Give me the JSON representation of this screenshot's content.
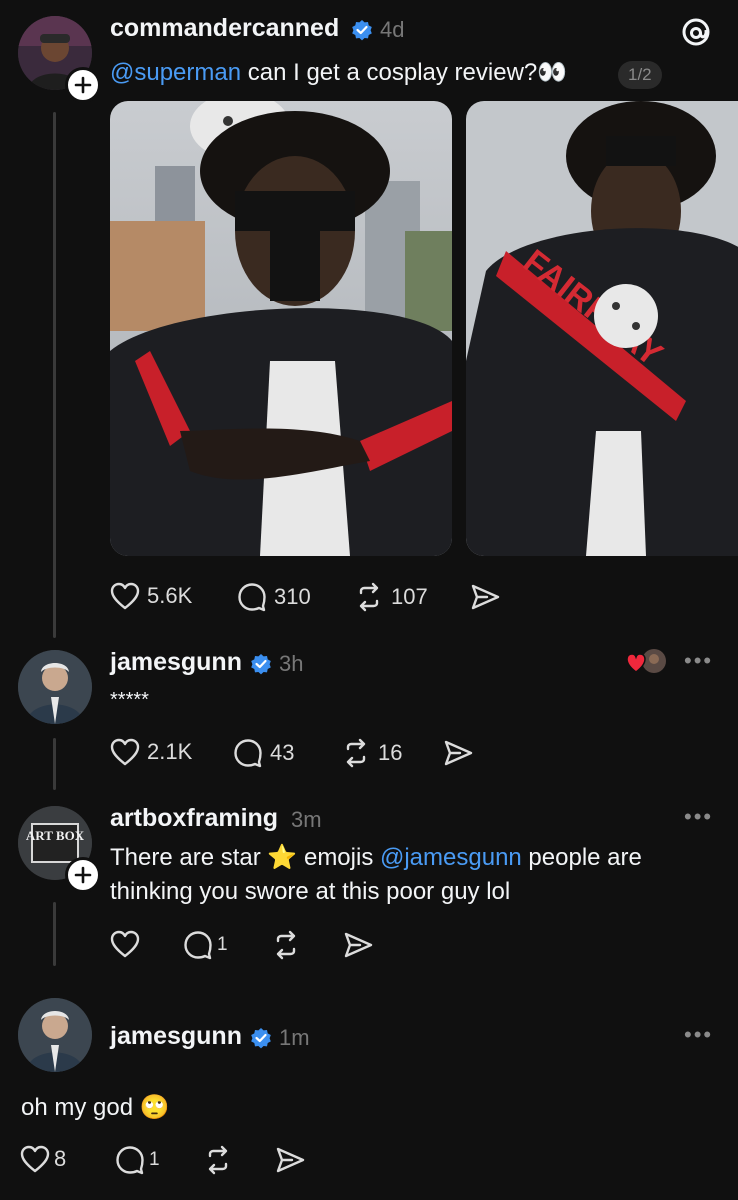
{
  "post": {
    "username": "commandercanned",
    "time": "4d",
    "mention": "@superman",
    "text": " can I get a cosplay review?👀",
    "media_counter": "1/2",
    "likes": "5.6K",
    "replies": "310",
    "reposts": "107"
  },
  "reply1": {
    "username": "jamesgunn",
    "time": "3h",
    "text": "*****",
    "likes": "2.1K",
    "replies": "43",
    "reposts": "16"
  },
  "reply2": {
    "username": "artboxframing",
    "time": "3m",
    "line1_a": "There are star ",
    "line1_b": " emojis ",
    "mention": "@jamesgunn",
    "line1_c": " people are",
    "line2": "thinking you swore at this poor guy lol",
    "replies": "1",
    "avatar_logo": "ART BOX"
  },
  "reply3": {
    "username": "jamesgunn",
    "time": "1m",
    "text": "oh my god 🙄",
    "likes": "8",
    "replies": "1"
  },
  "colors": {
    "background": "#101010",
    "mention": "#4a9bf4",
    "verified": "#3b8ff0",
    "muted": "#777777"
  },
  "icons": [
    "threads-logo-icon",
    "verified-icon",
    "heart-icon",
    "comment-icon",
    "repost-icon",
    "share-icon",
    "more-icon",
    "follow-plus-icon"
  ]
}
